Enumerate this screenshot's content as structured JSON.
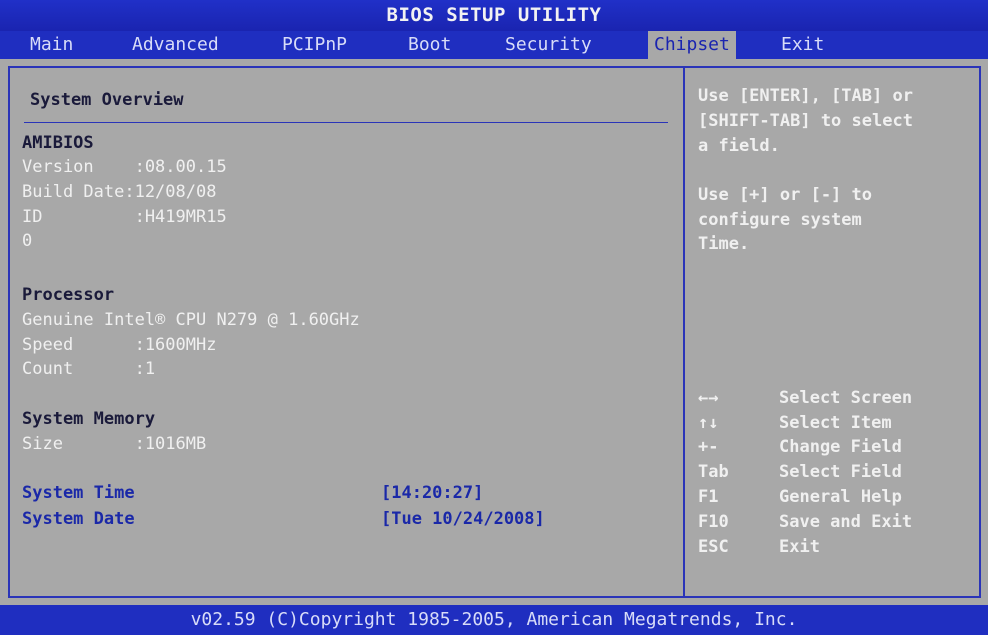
{
  "title": "BIOS SETUP UTILITY",
  "menu": [
    "Main",
    "Advanced",
    "PCIPnP",
    "Boot",
    "Security",
    "Chipset",
    "Exit"
  ],
  "active_menu": "Chipset",
  "section_title": "System Overview",
  "bios": {
    "heading": "AMIBIOS",
    "version": "Version    :08.00.15",
    "build_date": "Build Date:12/08/08",
    "id": "ID         :H419MR15",
    "extra": "0"
  },
  "processor": {
    "heading": "Processor",
    "name": "Genuine Intel® CPU N279 @ 1.60GHz",
    "speed": "Speed      :1600MHz",
    "count": "Count      :1"
  },
  "memory": {
    "heading": "System Memory",
    "size": "Size       :1016MB"
  },
  "time": {
    "label": "System Time",
    "value": "[14:20:27]"
  },
  "date": {
    "label": "System Date",
    "value": "[Tue 10/24/2008]"
  },
  "help": {
    "line1": "Use [ENTER], [TAB] or",
    "line2": "[SHIFT-TAB] to select",
    "line3": "a field.",
    "line4": "Use [+] or [-] to",
    "line5": "configure system",
    "line6": "Time."
  },
  "keys": [
    {
      "key": "←→",
      "desc": "Select Screen"
    },
    {
      "key": "↑↓",
      "desc": "Select Item"
    },
    {
      "key": "+-",
      "desc": "Change Field"
    },
    {
      "key": "Tab",
      "desc": "Select Field"
    },
    {
      "key": "F1",
      "desc": "General Help"
    },
    {
      "key": "F10",
      "desc": "Save and Exit"
    },
    {
      "key": "ESC",
      "desc": "Exit"
    }
  ],
  "footer": "v02.59 (C)Copyright 1985-2005, American Megatrends, Inc."
}
